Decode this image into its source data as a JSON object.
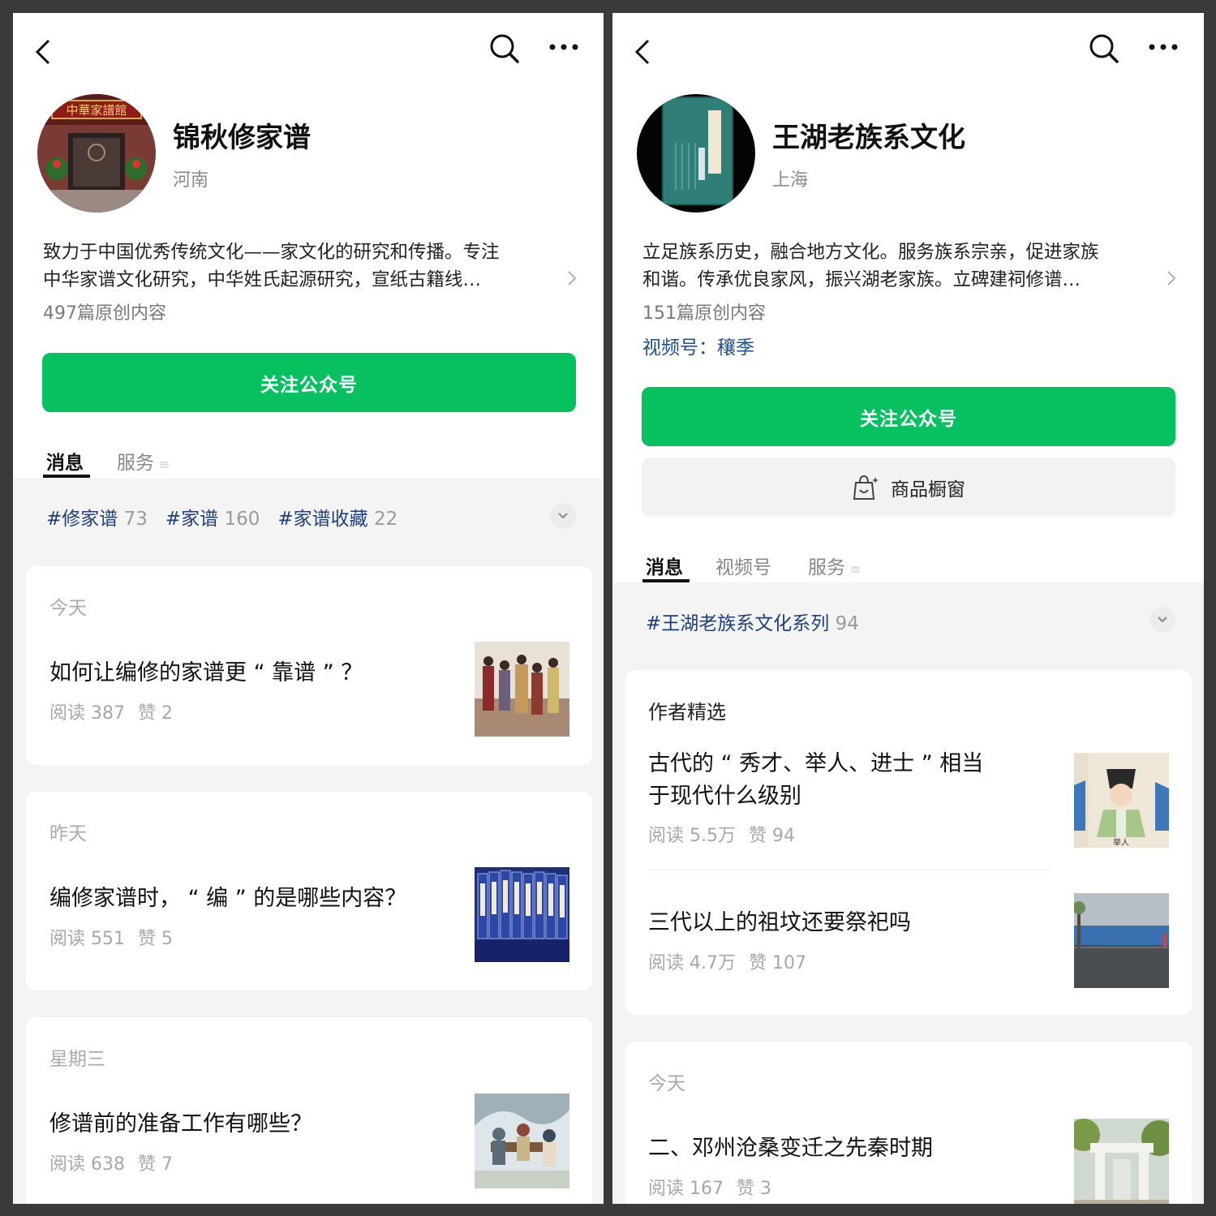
{
  "left": {
    "name": "锦秋修家谱",
    "location": "河南",
    "desc_line1": "致力于中国优秀传统文化——家文化的研究和传播。专注",
    "desc_line2": "中华家谱文化研究，中华姓氏起源研究，宣纸古籍线…",
    "original_count": "497篇原创内容",
    "follow_label": "关注公众号",
    "avatar_sign": "中華家譜館",
    "tabs": [
      "消息",
      "服务"
    ],
    "tags": [
      {
        "label": "#修家谱",
        "count": "73"
      },
      {
        "label": "#家谱",
        "count": "160"
      },
      {
        "label": "#家谱收藏",
        "count": "22"
      }
    ],
    "articles": [
      {
        "date": "今天",
        "title": "如何让编修的家谱更 “ 靠谱 ” ？",
        "reads": "阅读 387",
        "likes": "赞 2"
      },
      {
        "date": "昨天",
        "title": "编修家谱时， “ 编 ” 的是哪些内容？",
        "reads": "阅读 551",
        "likes": "赞 5"
      },
      {
        "date": "星期三",
        "title": "修谱前的准备工作有哪些？",
        "reads": "阅读 638",
        "likes": "赞 7"
      }
    ]
  },
  "right": {
    "name": "王湖老族系文化",
    "location": "上海",
    "desc_line1": "立足族系历史，融合地方文化。服务族系宗亲，促进家族",
    "desc_line2": "和谐。传承优良家风，振兴湖老家族。立碑建祠修谱…",
    "original_count": "151篇原创内容",
    "video_label": "视频号：",
    "video_name": "穰季",
    "follow_label": "关注公众号",
    "shop_label": "商品橱窗",
    "tabs": [
      "消息",
      "视频号",
      "服务"
    ],
    "tags": [
      {
        "label": "#王湖老族系文化系列",
        "count": "94"
      }
    ],
    "picks_title": "作者精选",
    "picks": [
      {
        "title_line1": "古代的 “ 秀才、举人、进士 ” 相当",
        "title_line2": "于现代什么级别",
        "reads": "阅读 5.5万",
        "likes": "赞 94",
        "thumb_caption": "举人"
      },
      {
        "title_line1": "三代以上的祖坟还要祭祀吗",
        "reads": "阅读 4.7万",
        "likes": "赞 107"
      }
    ],
    "today": {
      "date": "今天",
      "title": "二、邓州沧桑变迁之先秦时期",
      "reads": "阅读 167",
      "likes": "赞 3"
    }
  },
  "colors": {
    "accent_green": "#07c160",
    "tag_blue": "#1e3f82",
    "link_blue": "#1e4f8f"
  },
  "icons": [
    "back-arrow-icon",
    "search-icon",
    "more-dots-icon",
    "chevron-right-icon",
    "chevron-down-icon",
    "shop-bag-icon"
  ]
}
